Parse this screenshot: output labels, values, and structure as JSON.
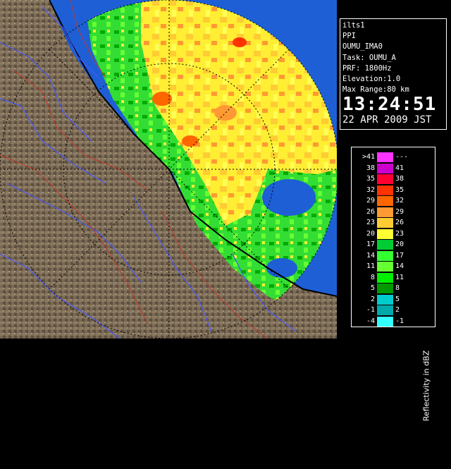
{
  "info": {
    "site": "ilts1",
    "product": "PPI",
    "volume": "OUMU_IMA0",
    "task": "Task: OUMU_A",
    "prf": "PRF: 1800Hz",
    "elevation": "Elevation:1.0",
    "max_range": "Max Range:80 km",
    "time": "13:24:51",
    "date": "22 APR 2009 JST"
  },
  "legend": {
    "title": "Reflectivity in dBZ",
    "rows": [
      {
        "lo": ">41",
        "hi": "---",
        "color": "#ff33ff"
      },
      {
        "lo": "38",
        "hi": "41",
        "color": "#cc00cc"
      },
      {
        "lo": "35",
        "hi": "38",
        "color": "#ff0033"
      },
      {
        "lo": "32",
        "hi": "35",
        "color": "#ff3300"
      },
      {
        "lo": "29",
        "hi": "32",
        "color": "#ff6600"
      },
      {
        "lo": "26",
        "hi": "29",
        "color": "#ff9933"
      },
      {
        "lo": "23",
        "hi": "26",
        "color": "#ffcc33"
      },
      {
        "lo": "20",
        "hi": "23",
        "color": "#ffff33"
      },
      {
        "lo": "17",
        "hi": "20",
        "color": "#00cc33"
      },
      {
        "lo": "14",
        "hi": "17",
        "color": "#33ff33"
      },
      {
        "lo": "11",
        "hi": "14",
        "color": "#66ff33"
      },
      {
        "lo": "8",
        "hi": "11",
        "color": "#00ee00"
      },
      {
        "lo": "5",
        "hi": "8",
        "color": "#009900"
      },
      {
        "lo": "2",
        "hi": "5",
        "color": "#00cccc"
      },
      {
        "lo": "-1",
        "hi": "2",
        "color": "#00aaaa"
      },
      {
        "lo": "-4",
        "hi": "-1",
        "color": "#33ffff"
      }
    ]
  },
  "colors": {
    "sea": "#1e5fd6",
    "land": "#7a6a55",
    "coast": "#000000",
    "rivers": "#4a5aff",
    "roads": "#c0392b",
    "range_rings": "#000000"
  }
}
